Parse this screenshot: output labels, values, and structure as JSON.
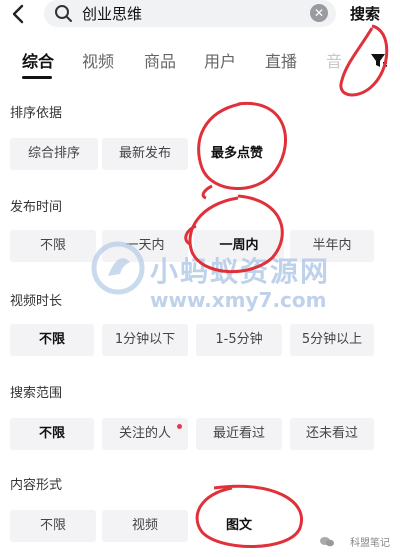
{
  "search": {
    "query": "创业思维",
    "button": "搜索"
  },
  "tabs": [
    "综合",
    "视频",
    "商品",
    "用户",
    "直播",
    "音"
  ],
  "sections": [
    {
      "label": "排序依据",
      "options": [
        "综合排序",
        "最新发布",
        "最多点赞"
      ],
      "selected": "最多点赞"
    },
    {
      "label": "发布时间",
      "options": [
        "不限",
        "一天内",
        "一周内",
        "半年内"
      ],
      "selected": "一周内"
    },
    {
      "label": "视频时长",
      "options": [
        "不限",
        "1分钟以下",
        "1-5分钟",
        "5分钟以上"
      ],
      "selected": "不限"
    },
    {
      "label": "搜索范围",
      "options": [
        "不限",
        "关注的人",
        "最近看过",
        "还未看过"
      ],
      "selected": "不限"
    },
    {
      "label": "内容形式",
      "options": [
        "不限",
        "视频",
        "图文"
      ],
      "selected": "图文"
    }
  ],
  "watermark": {
    "line1": "小蚂蚁资源网",
    "line2": "www.xmy7.com"
  },
  "brand": "科盟笔记",
  "colors": {
    "annotation": "#e0303a",
    "watermark": "#b5cbe8",
    "notice_dot": "#e33b4f"
  }
}
